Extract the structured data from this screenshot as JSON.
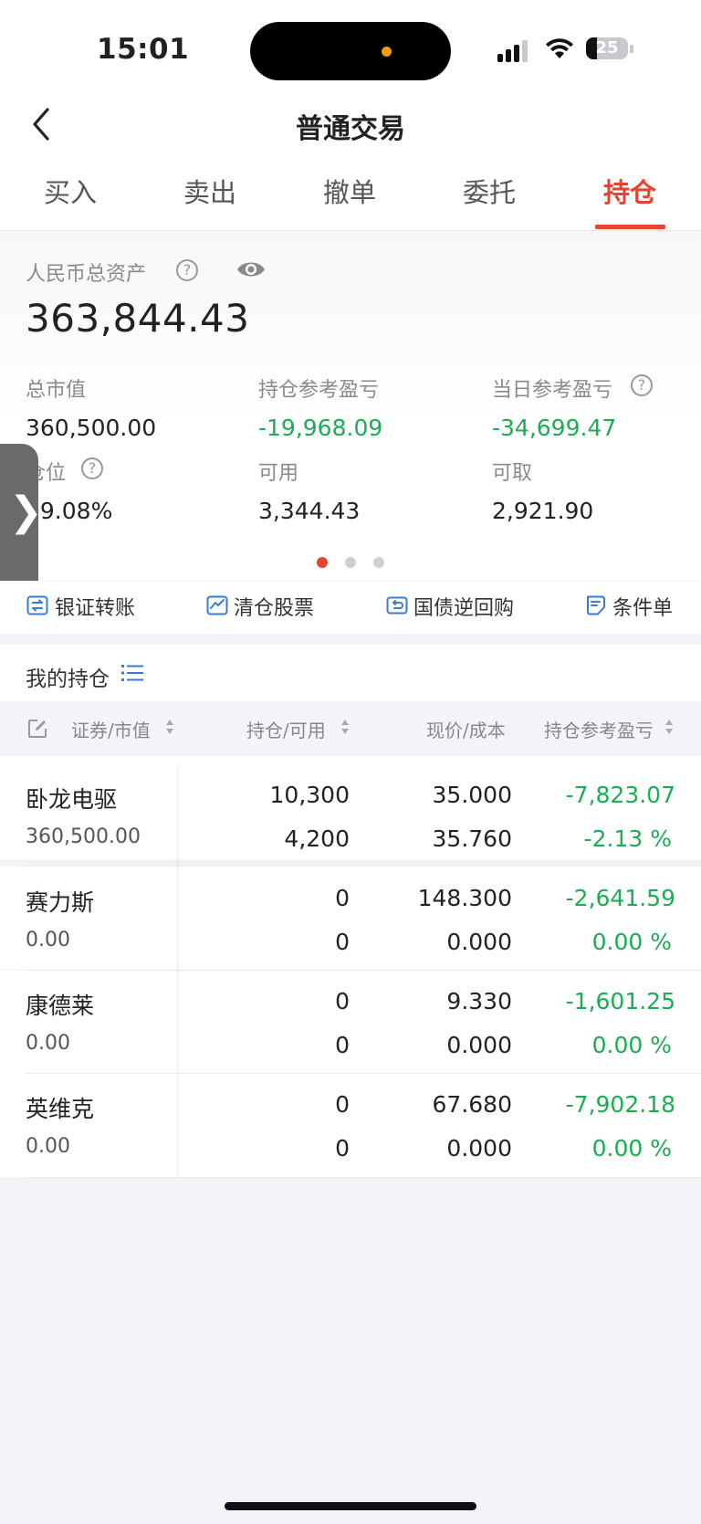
{
  "status_bar": {
    "time": "15:01",
    "battery": "25",
    "battery_level": 0.25
  },
  "nav": {
    "title": "普通交易"
  },
  "tabs": [
    {
      "label": "买入",
      "active": false
    },
    {
      "label": "卖出",
      "active": false
    },
    {
      "label": "撤单",
      "active": false
    },
    {
      "label": "委托",
      "active": false
    },
    {
      "label": "持仓",
      "active": true
    }
  ],
  "assets": {
    "total_label": "人民币总资产",
    "total_value": "363,844.43",
    "market_value_label": "总市值",
    "market_value": "360,500.00",
    "position_pl_label": "持仓参考盈亏",
    "position_pl": "-19,968.09",
    "daily_pl_label": "当日参考盈亏",
    "daily_pl": "-34,699.47",
    "position_ratio_label": "仓位",
    "position_ratio": "99.08%",
    "available_label": "可用",
    "available": "3,344.43",
    "withdrawable_label": "可取",
    "withdrawable": "2,921.90"
  },
  "quick_actions": [
    {
      "label": "银证转账",
      "icon": "bank-transfer-icon"
    },
    {
      "label": "清仓股票",
      "icon": "clear-position-icon"
    },
    {
      "label": "国债逆回购",
      "icon": "reverse-repo-icon"
    },
    {
      "label": "条件单",
      "icon": "conditional-order-icon"
    }
  ],
  "holdings": {
    "title": "我的持仓",
    "columns": {
      "security": "证券/市值",
      "position": "持仓/可用",
      "price": "现价/成本",
      "pl": "持仓参考盈亏"
    },
    "rows": [
      {
        "name": "卧龙电驱",
        "market_value": "360,500.00",
        "position": "10,300",
        "available": "4,200",
        "price": "35.000",
        "cost": "35.760",
        "pl": "-7,823.07",
        "pl_pct": "-2.13 %"
      },
      {
        "name": "赛力斯",
        "market_value": "0.00",
        "position": "0",
        "available": "0",
        "price": "148.300",
        "cost": "0.000",
        "pl": "-2,641.59",
        "pl_pct": "0.00 %"
      },
      {
        "name": "康德莱",
        "market_value": "0.00",
        "position": "0",
        "available": "0",
        "price": "9.330",
        "cost": "0.000",
        "pl": "-1,601.25",
        "pl_pct": "0.00 %"
      },
      {
        "name": "英维克",
        "market_value": "0.00",
        "position": "0",
        "available": "0",
        "price": "67.680",
        "cost": "0.000",
        "pl": "-7,902.18",
        "pl_pct": "0.00 %"
      }
    ]
  },
  "colors": {
    "accent": "#e3452e",
    "loss_green": "#1aad52"
  }
}
